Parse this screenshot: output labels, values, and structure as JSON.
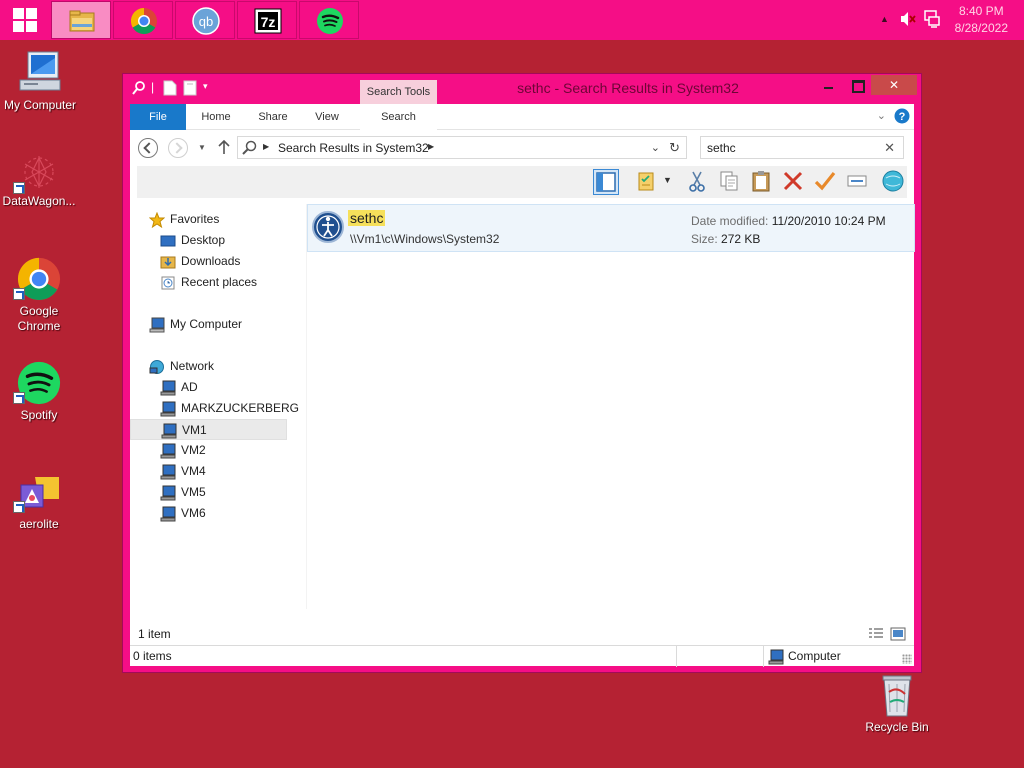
{
  "taskbar": {
    "apps": [
      {
        "name": "file-explorer"
      },
      {
        "name": "chrome"
      },
      {
        "name": "qbittorrent",
        "label": "qb"
      },
      {
        "name": "7zip",
        "label": "7z"
      },
      {
        "name": "spotify"
      }
    ],
    "clock": {
      "time": "8:40 PM",
      "date": "8/28/2022"
    }
  },
  "desktop": {
    "icons": [
      {
        "label": "My Computer"
      },
      {
        "label": "DataWagon..."
      },
      {
        "label": "Google Chrome"
      },
      {
        "label": "Spotify"
      },
      {
        "label": "aerolite"
      },
      {
        "label": "Recycle Bin"
      }
    ]
  },
  "window": {
    "title": "sethc - Search Results in System32",
    "context_tab": "Search Tools",
    "ribbon_tabs": [
      "File",
      "Home",
      "Share",
      "View",
      "Search"
    ],
    "address": {
      "crumb": "Search Results in System32"
    },
    "search": {
      "value": "sethc"
    },
    "nav": {
      "favorites": {
        "label": "Favorites",
        "items": [
          "Desktop",
          "Downloads",
          "Recent places"
        ]
      },
      "computer": "My Computer",
      "network": {
        "label": "Network",
        "items": [
          "AD",
          "MARKZUCKERBERG",
          "VM1",
          "VM2",
          "VM4",
          "VM5",
          "VM6"
        ],
        "selected": "VM1"
      }
    },
    "result": {
      "name": "sethc",
      "path": "\\\\Vm1\\c\\Windows\\System32",
      "date_label": "Date modified:",
      "date_value": "11/20/2010 10:24 PM",
      "size_label": "Size:",
      "size_value": "272 KB"
    },
    "status": {
      "count": "1 item",
      "selection": "0 items",
      "location": "Computer"
    }
  },
  "colors": {
    "desktop": "#b52233",
    "taskbar": "#f50e86",
    "window_frame": "#f50e86",
    "file_tab": "#1979ca",
    "highlight": "#f6e05b"
  }
}
